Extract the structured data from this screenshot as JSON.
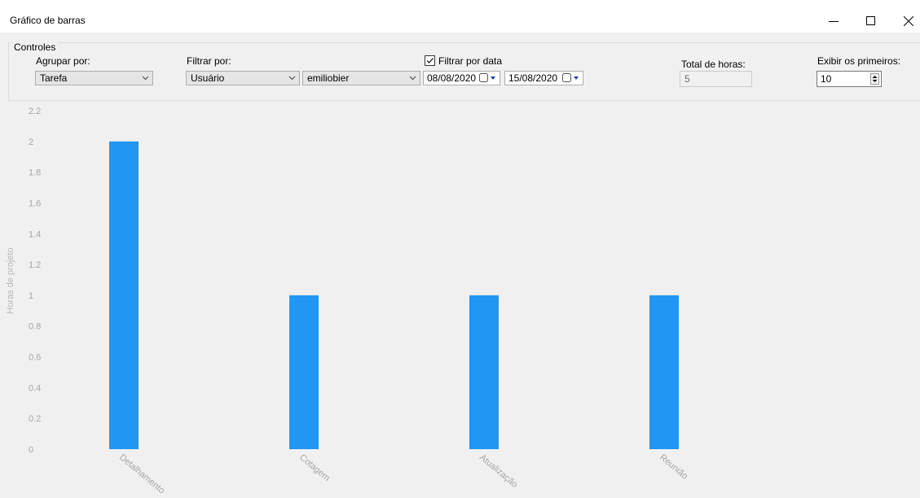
{
  "window": {
    "title": "Gráfico de barras"
  },
  "controls": {
    "group_label": "Controles",
    "group_by_label": "Agrupar por:",
    "group_by_value": "Tarefa",
    "filter_by_label": "Filtrar por:",
    "filter_by_value": "Usuário",
    "user_value": "emiliobier",
    "filter_date_label": "Filtrar por data",
    "filter_date_checked": true,
    "date_from": "08/08/2020",
    "date_to": "15/08/2020",
    "total_hours_label": "Total de horas:",
    "total_hours_value": "5",
    "show_first_label": "Exibir os primeiros:",
    "show_first_value": "10"
  },
  "colors": {
    "bar": "#2196f3",
    "background": "#f0f0f0"
  },
  "chart_data": {
    "type": "bar",
    "categories": [
      "Detalhamento",
      "Cotagem",
      "Atualização",
      "Reunião",
      ""
    ],
    "values": [
      2,
      1,
      1,
      1,
      0
    ],
    "title": "",
    "xlabel": "",
    "ylabel": "Horas de projeto",
    "ylim": [
      0,
      2.2
    ],
    "yticks": [
      "0",
      "0.2",
      "0.4",
      "0.6",
      "0.8",
      "1",
      "1.2",
      "1.4",
      "1.6",
      "1.8",
      "2",
      "2.2"
    ],
    "grid": false,
    "legend": "none"
  }
}
